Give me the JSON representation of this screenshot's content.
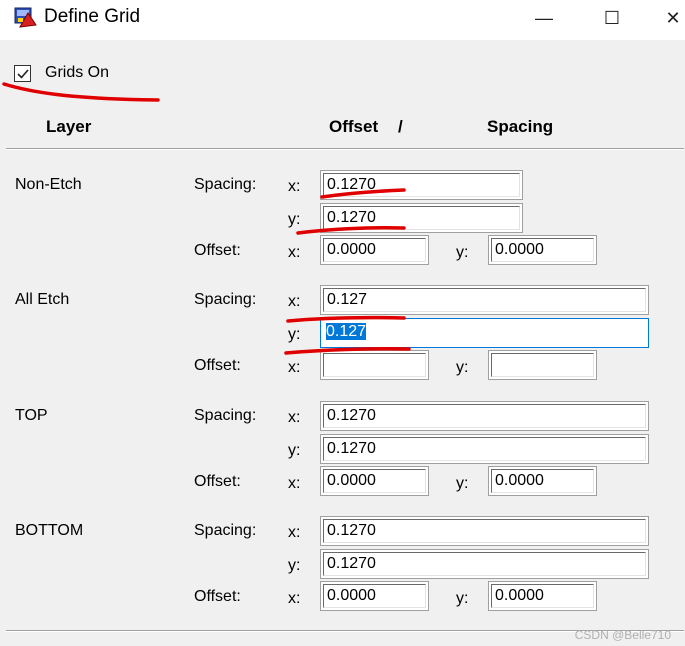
{
  "window": {
    "title": "Define Grid",
    "minimize_glyph": "—",
    "maximize_glyph": "☐",
    "close_glyph": "✕"
  },
  "grids_on": {
    "label": "Grids On",
    "checked": true
  },
  "headers": {
    "layer": "Layer",
    "offset": "Offset",
    "slash": "/",
    "spacing": "Spacing"
  },
  "labels": {
    "spacing": "Spacing:",
    "offset": "Offset:",
    "x": "x:",
    "y": "y:"
  },
  "layers": [
    {
      "name": "Non-Etch",
      "spacing_x": "0.1270",
      "spacing_y": "0.1270",
      "offset_x": "0.0000",
      "offset_y": "0.0000"
    },
    {
      "name": "All Etch",
      "spacing_x": "0.127",
      "spacing_y": "0.127",
      "offset_x": "",
      "offset_y": ""
    },
    {
      "name": "TOP",
      "spacing_x": "0.1270",
      "spacing_y": "0.1270",
      "offset_x": "0.0000",
      "offset_y": "0.0000"
    },
    {
      "name": "BOTTOM",
      "spacing_x": "0.1270",
      "spacing_y": "0.1270",
      "offset_x": "0.0000",
      "offset_y": "0.0000"
    }
  ],
  "watermark": "CSDN @Belle710",
  "colors": {
    "annotation": "#e00000",
    "selection": "#0078d7",
    "dialog_bg": "#f0f0f0"
  },
  "icons": [
    "app-icon",
    "check-icon",
    "minimize-icon",
    "maximize-icon",
    "close-icon"
  ]
}
